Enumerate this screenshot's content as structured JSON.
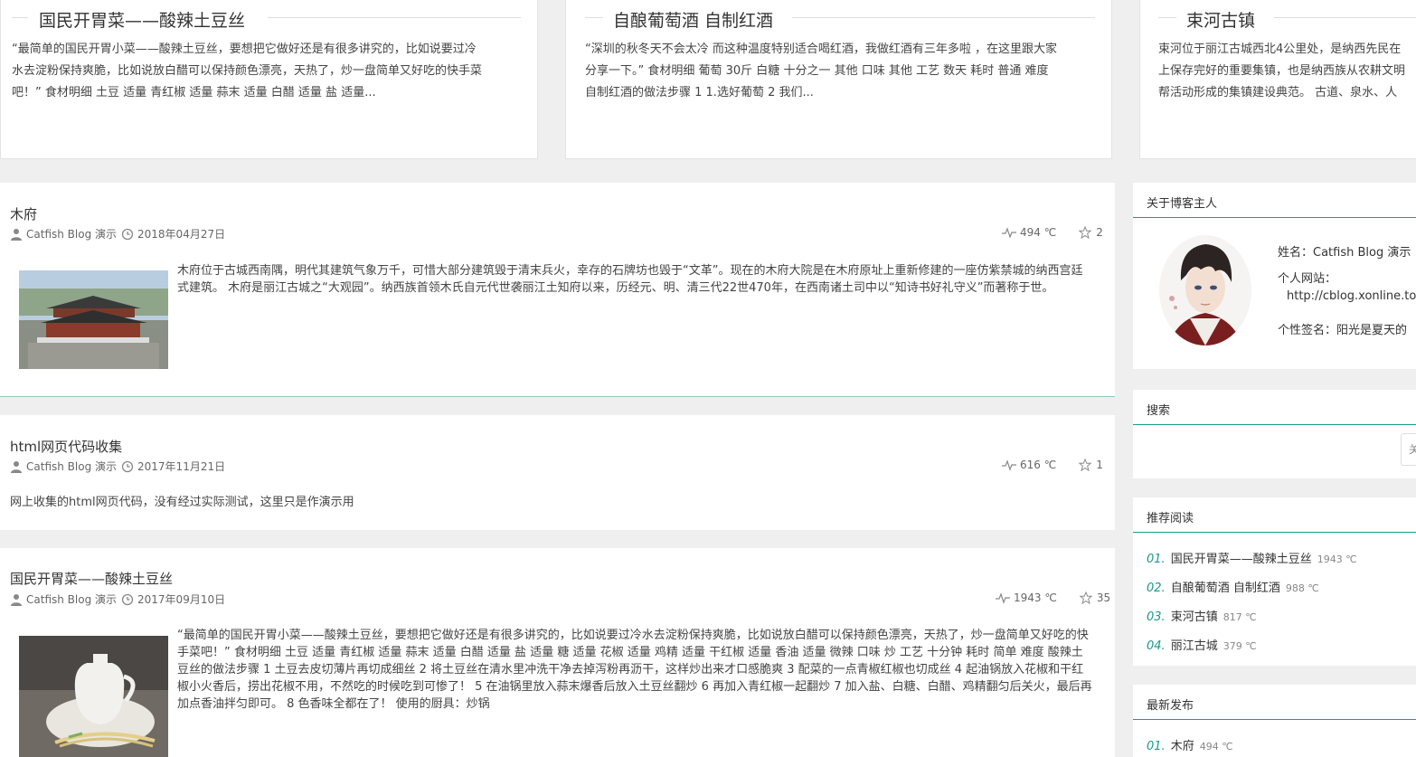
{
  "featured": [
    {
      "title": "国民开胃菜——酸辣土豆丝",
      "desc": "“最简单的国民开胃小菜——酸辣土豆丝，要想把它做好还是有很多讲究的，比如说要过冷\n水去淀粉保持爽脆，比如说放白醋可以保持颜色漂亮，天热了，炒一盘简单又好吃的快手菜\n吧！” 食材明细 土豆 适量 青红椒 适量 蒜末 适量 白醋 适量 盐 适量..."
    },
    {
      "title": "自酿葡萄酒 自制红酒",
      "desc": "“深圳的秋冬天不会太冷 而这种温度特别适合喝红酒，我做红酒有三年多啦 ，在这里跟大家\n分享一下。” 食材明细 葡萄 30斤 白糖 十分之一 其他 口味 其他 工艺 数天 耗时 普通 难度\n自制红酒的做法步骤 1 1.选好葡萄 2 我们..."
    },
    {
      "title": "束河古镇",
      "desc": "束河位于丽江古城西北4公里处，是纳西先民在\n上保存完好的重要集镇，也是纳西族从农耕文明\n帮活动形成的集镇建设典范。 古道、泉水、人"
    }
  ],
  "articles": [
    {
      "title": "木府",
      "author": "Catfish Blog 演示",
      "date": "2018年04月27日",
      "views": "494 ℃",
      "likes": "2",
      "body": "木府位于古城西南隅，明代其建筑气象万千，可惜大部分建筑毁于清末兵火，幸存的石牌坊也毁于“文革”。现在的木府大院是在木府原址上重新修建的一座仿紫禁城的纳西宫廷式建筑。 木府是丽江古城之“大观园”。纳西族首领木氏自元代世袭丽江土知府以来，历经元、明、清三代22世470年，在西南诸土司中以“知诗书好礼守义”而著称于世。"
    },
    {
      "title": "html网页代码收集",
      "author": "Catfish Blog 演示",
      "date": "2017年11月21日",
      "views": "616 ℃",
      "likes": "1",
      "body": "网上收集的html网页代码，没有经过实际测试，这里只是作演示用"
    },
    {
      "title": "国民开胃菜——酸辣土豆丝",
      "author": "Catfish Blog 演示",
      "date": "2017年09月10日",
      "views": "1943 ℃",
      "likes": "35",
      "body": "“最简单的国民开胃小菜——酸辣土豆丝，要想把它做好还是有很多讲究的，比如说要过冷水去淀粉保持爽脆，比如说放白醋可以保持颜色漂亮，天热了，炒一盘简单又好吃的快手菜吧！” 食材明细 土豆 适量 青红椒 适量 蒜末 适量 白醋 适量 盐 适量 糖 适量 花椒 适量 鸡精 适量 干红椒 适量 香油 适量 微辣 口味 炒 工艺 十分钟 耗时 简单 难度 酸辣土豆丝的做法步骤 1 土豆去皮切薄片再切成细丝 2 将土豆丝在清水里冲洗干净去掉泻粉再沥干，这样炒出来才口感脆爽 3 配菜的一点青椒红椒也切成丝 4 起油锅放入花椒和干红椒小火香后，捞出花椒不用，不然吃的时候吃到可惨了！ 5 在油锅里放入蒜末爆香后放入土豆丝翻炒 6 再加入青红椒一起翻炒 7 加入盐、白糖、白醋、鸡精翻匀后关火，最后再加点香油拌匀即可。 8 色香味全都在了！ 使用的厨具：炒锅"
    }
  ],
  "sidebar": {
    "about": {
      "heading": "关于博客主人",
      "name": "姓名：Catfish Blog 演示",
      "site_label": "个人网站：",
      "site_url": "http://cblog.xonline.top",
      "signature": "个性签名：阳光是夏天的"
    },
    "search": {
      "heading": "搜索",
      "button": "关"
    },
    "recommended": {
      "heading": "推荐阅读",
      "items": [
        {
          "num": "01.",
          "title": "国民开胃菜——酸辣土豆丝",
          "temp": "1943 ℃"
        },
        {
          "num": "02.",
          "title": "自酿葡萄酒 自制红酒",
          "temp": "988 ℃"
        },
        {
          "num": "03.",
          "title": "束河古镇",
          "temp": "817 ℃"
        },
        {
          "num": "04.",
          "title": "丽江古城",
          "temp": "379 ℃"
        }
      ]
    },
    "latest": {
      "heading": "最新发布",
      "items": [
        {
          "num": "01.",
          "title": "木府",
          "temp": "494 ℃"
        }
      ]
    }
  },
  "colors": {
    "accent": "#1a9a8a",
    "separator": "#88c7bb",
    "background": "#efefef"
  }
}
